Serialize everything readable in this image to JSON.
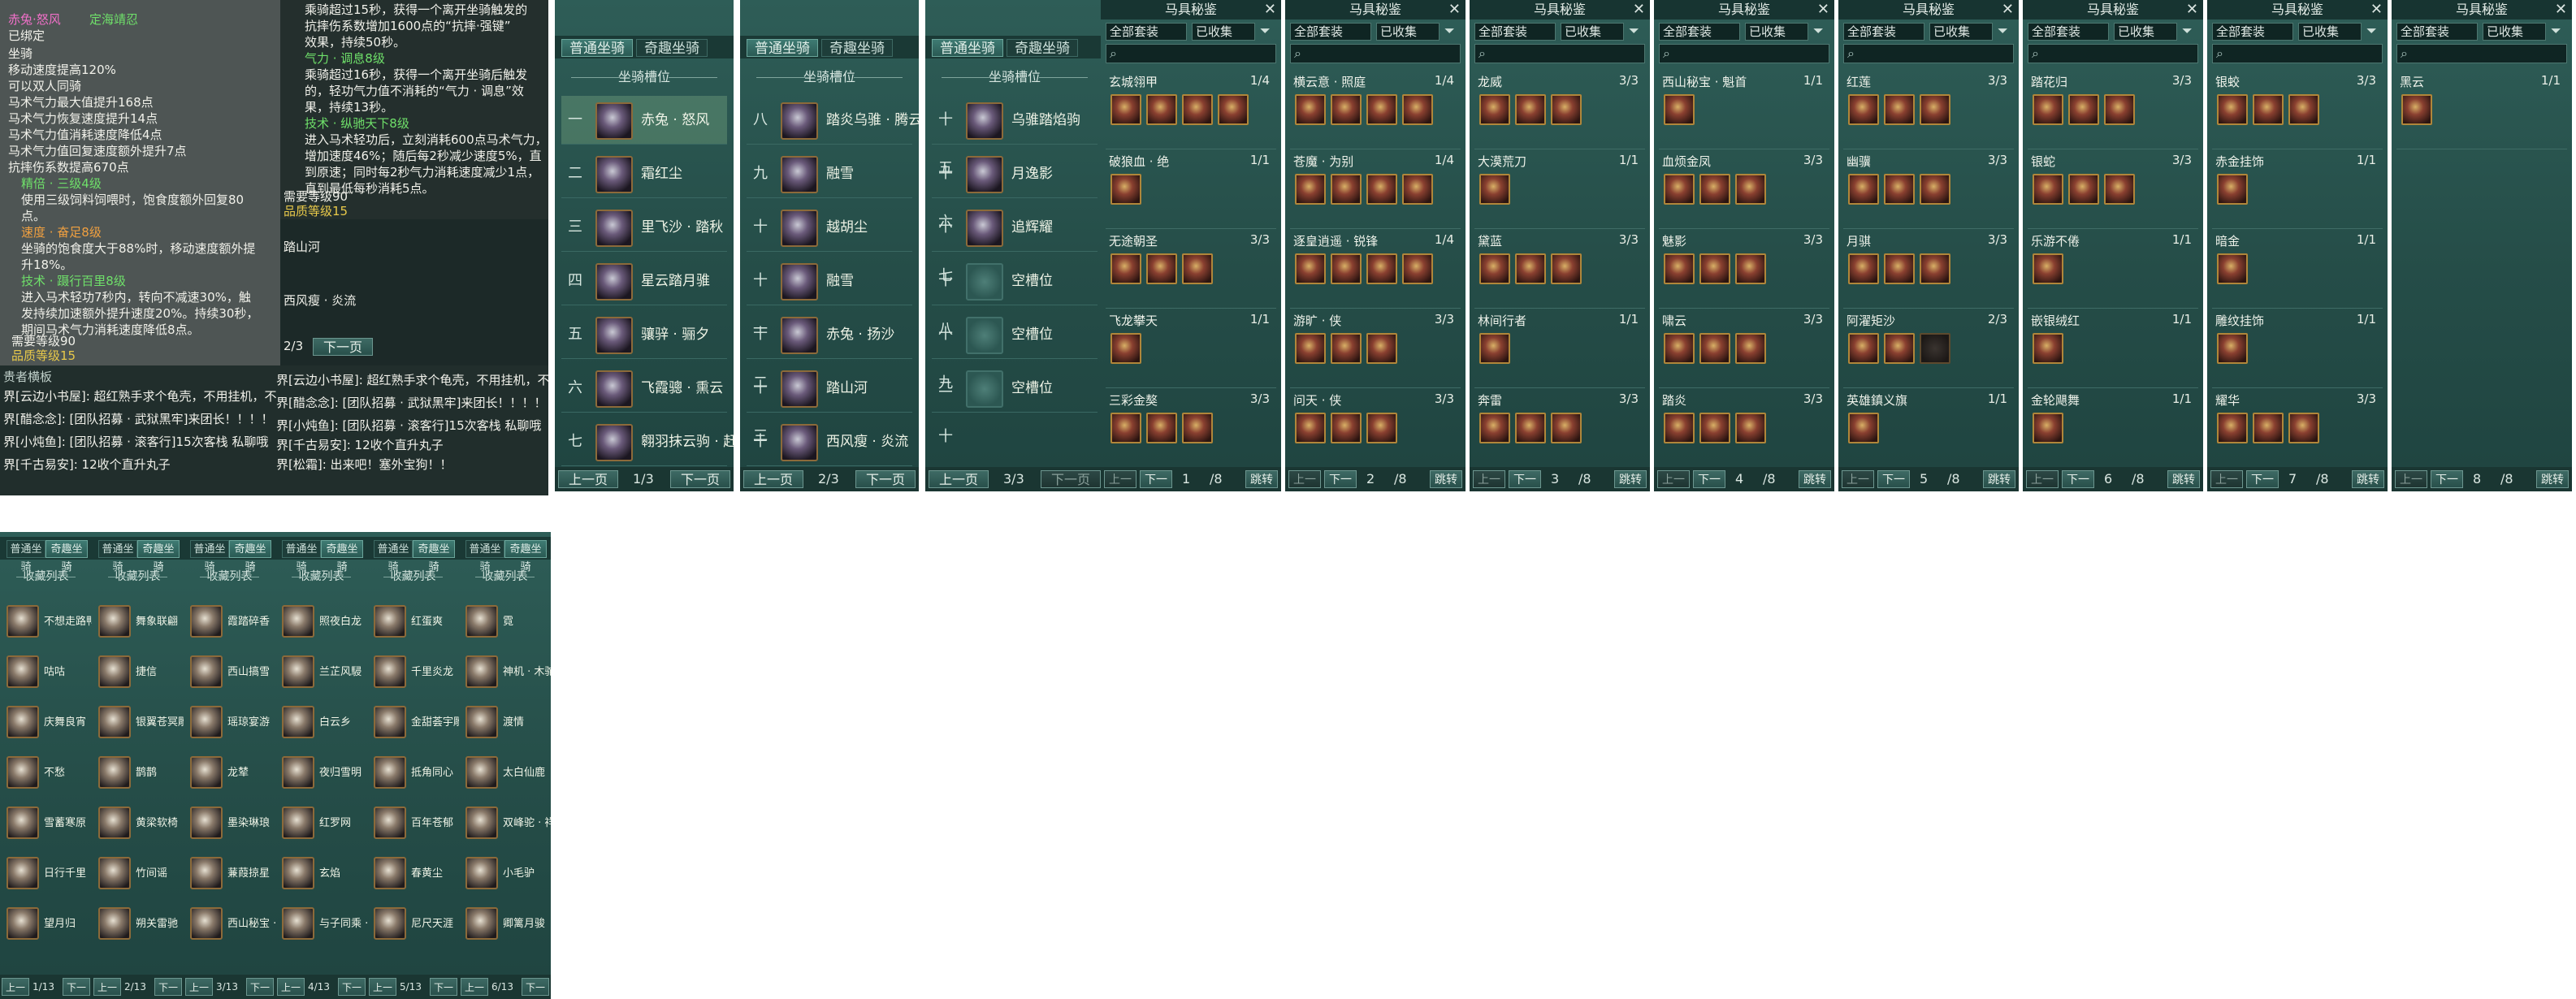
{
  "colors": {
    "teal_bg": "#2e5d57",
    "quality_gold": "#e8c94a",
    "skill_green": "#6fe06a",
    "title_pink": "#f070c8"
  },
  "tooltip": {
    "title": "赤兔·怒风",
    "tag": "定海靖忍",
    "status": "已绑定",
    "lines": [
      "坐骑",
      "移动速度提高120%",
      "可以双人同骑",
      "马术气力最大值提升168点",
      "马术气力恢复速度提升14点",
      "马术气力值消耗速度降低4点",
      "马术气力值回复速度额外提升7点",
      "抗摔伤系数提高670点"
    ],
    "skills": [
      {
        "name": "精倍 · 三级4级",
        "lines": [
          "使用三级饲料饲喂时，饱食度额外回复80",
          "点。"
        ]
      },
      {
        "name": "速度 · 奋足8级",
        "lines": [
          "坐骑的饱食度大于88%时，移动速度额外提",
          "升18%。"
        ]
      },
      {
        "name": "技术 · 蹑行百里8级",
        "lines": [
          "进入马术轻功7秒内，转向不减速30%，触",
          "发持续加速额外提升速度20%。持续30秒，",
          "期间马术气力消耗速度降低8点。"
        ]
      }
    ],
    "req_level": "需要等级90",
    "quality": "品质等级15",
    "right_lines": [
      "乘骑超过15秒，获得一个离开坐骑触发的",
      "抗摔伤系数增加1600点的“抗摔·强键”",
      "效果，持续50秒。"
    ],
    "right_skills": [
      {
        "name": "气力 · 调息8级",
        "lines": [
          "乘骑超过16秒，获得一个离开坐骑后触发",
          "的，轻功气力值不消耗的“气力 · 调息”效",
          "果，持续13秒。"
        ]
      },
      {
        "name": "技术 · 纵驰天下8级",
        "lines": [
          "进入马术轻功后，立刻消耗600点马术气力，",
          "增加速度46%；随后每2秒减少速度5%，直",
          "到原速；同时每2秒气力消耗速度减少1点，",
          "直到最低每秒消耗5点。"
        ]
      }
    ],
    "right_req": "需要等级90",
    "right_quality": "品质等级15"
  },
  "chat": {
    "lines": [
      "界[云边小书屋]: 超红熟手求个龟壳，不用挂机，不",
      "界[醋念念]: [团队招募 · 武狱黑牢]来团长！！！！",
      "界[小炖鱼]: [团队招募 · 滚客行]15次客栈 私聊哦",
      "界[千古易安]: 12收个直升丸子"
    ],
    "lines_b": [
      "界[云边小书屋]: 超红熟手求个龟壳，不用挂机，不",
      "界[醋念念]: [团队招募 · 武狱黑牢]来团长！！！！",
      "界[小炖鱼]: [团队招募 · 滚客行]15次客栈 私聊哦",
      "界[千古易安]: 12收个直升丸子",
      "界[松霜]: 出来吧！塞外宝狗！！"
    ],
    "top_line": "界[云边小书屋]: [团队招募·滚客行]15次宝阁 私聊哦",
    "top_line2": "贵者横板",
    "map_names": [
      "踏山河",
      "西风瘦 · 炎流"
    ],
    "page": "2/3",
    "next": "下一页"
  },
  "riding": {
    "tab_normal": "普通坐骑",
    "tab_wonder": "奇趣坐骑",
    "header": "坐骑槽位",
    "panels": [
      {
        "page": "1/3",
        "prev": "上一页",
        "next": "下一页",
        "items": [
          {
            "num": "一",
            "name": "赤兔 · 怒风",
            "sel": true
          },
          {
            "num": "二",
            "name": "霜红尘"
          },
          {
            "num": "三",
            "name": "里飞沙 · 踏秋"
          },
          {
            "num": "四",
            "name": "星云踏月骓"
          },
          {
            "num": "五",
            "name": "骧骍 · 骊夕"
          },
          {
            "num": "六",
            "name": "飞霞骢 · 熏云"
          },
          {
            "num": "七",
            "name": "翱羽抹云驹 · 赶月"
          }
        ]
      },
      {
        "page": "2/3",
        "prev": "上一页",
        "next": "下一页",
        "items": [
          {
            "num": "八",
            "name": "踏炎乌骓 · 腾云"
          },
          {
            "num": "九",
            "name": "融雪"
          },
          {
            "num": "十",
            "name": "越胡尘"
          },
          {
            "num": "十一",
            "name": "融雪"
          },
          {
            "num": "十二",
            "name": "赤兔 · 扬沙"
          },
          {
            "num": "十三",
            "name": "踏山河"
          },
          {
            "num": "十四",
            "name": "西风瘦 · 炎流"
          }
        ]
      },
      {
        "page": "3/3",
        "prev": "上一页",
        "next": "下一页",
        "items": [
          {
            "num": "十五",
            "name": "乌骓踏焰驹"
          },
          {
            "num": "十六",
            "name": "月逸影"
          },
          {
            "num": "十七",
            "name": "追辉耀"
          },
          {
            "num": "十八",
            "name": "空槽位",
            "empty": true
          },
          {
            "num": "十九",
            "name": "空槽位",
            "empty": true
          },
          {
            "num": "二十",
            "name": "空槽位",
            "empty": true
          }
        ]
      }
    ]
  },
  "equip": {
    "title": "马具秘鉴",
    "filter1": "全部套装",
    "filter2": "已收集",
    "prev": "上一页",
    "next": "下一页",
    "jump": "跳转",
    "total": "/8",
    "panels": [
      {
        "page": "1",
        "sets": [
          {
            "name": "玄城翎甲",
            "count": "1/4",
            "icons": 4
          },
          {
            "name": "破狼血 · 绝",
            "count": "1/1",
            "icons": 1
          },
          {
            "name": "无途朝圣",
            "count": "3/3",
            "icons": 3
          },
          {
            "name": "飞龙攀天",
            "count": "1/1",
            "icons": 1
          },
          {
            "name": "三彩金獒",
            "count": "3/3",
            "icons": 3
          }
        ]
      },
      {
        "page": "2",
        "sets": [
          {
            "name": "横云意 · 照庭",
            "count": "1/4",
            "icons": 4
          },
          {
            "name": "苍魔 · 为别",
            "count": "1/4",
            "icons": 4
          },
          {
            "name": "逐皇逍遥 · 锐锋",
            "count": "1/4",
            "icons": 4
          },
          {
            "name": "游旷 · 侠",
            "count": "3/3",
            "icons": 3
          },
          {
            "name": "问天 · 侠",
            "count": "3/3",
            "icons": 3
          }
        ]
      },
      {
        "page": "3",
        "sets": [
          {
            "name": "龙威",
            "count": "3/3",
            "icons": 3
          },
          {
            "name": "大漠荒刀",
            "count": "1/1",
            "icons": 1
          },
          {
            "name": "黛蓝",
            "count": "3/3",
            "icons": 3
          },
          {
            "name": "林间行者",
            "count": "1/1",
            "icons": 1
          },
          {
            "name": "奔雷",
            "count": "3/3",
            "icons": 3
          }
        ]
      },
      {
        "page": "4",
        "sets": [
          {
            "name": "西山秘宝 · 魁首",
            "count": "1/1",
            "icons": 1
          },
          {
            "name": "血烦金凤",
            "count": "3/3",
            "icons": 3
          },
          {
            "name": "魅影",
            "count": "3/3",
            "icons": 3
          },
          {
            "name": "啸云",
            "count": "3/3",
            "icons": 3
          },
          {
            "name": "踏炎",
            "count": "3/3",
            "icons": 3
          }
        ]
      },
      {
        "page": "5",
        "sets": [
          {
            "name": "红莲",
            "count": "3/3",
            "icons": 3
          },
          {
            "name": "幽骥",
            "count": "3/3",
            "icons": 3
          },
          {
            "name": "月骐",
            "count": "3/3",
            "icons": 3
          },
          {
            "name": "阿濯矩沙",
            "count": "2/3",
            "icons": 2
          },
          {
            "name": "英雄鎮义旗",
            "count": "1/1",
            "icons": 1
          }
        ]
      },
      {
        "page": "6",
        "sets": [
          {
            "name": "踏花归",
            "count": "3/3",
            "icons": 3
          },
          {
            "name": "银蛇",
            "count": "3/3",
            "icons": 3
          },
          {
            "name": "乐游不倦",
            "count": "1/1",
            "icons": 1
          },
          {
            "name": "嵌银绒红",
            "count": "1/1",
            "icons": 1
          },
          {
            "name": "金轮飓舞",
            "count": "1/1",
            "icons": 1
          }
        ]
      },
      {
        "page": "7",
        "sets": [
          {
            "name": "银蛟",
            "count": "3/3",
            "icons": 3
          },
          {
            "name": "赤金挂饰",
            "count": "1/1",
            "icons": 1
          },
          {
            "name": "暗金",
            "count": "1/1",
            "icons": 1
          },
          {
            "name": "雕纹挂饰",
            "count": "1/1",
            "icons": 1
          },
          {
            "name": "耀华",
            "count": "3/3",
            "icons": 3
          }
        ]
      },
      {
        "page": "8",
        "sets": [
          {
            "name": "黑云",
            "count": "1/1",
            "icons": 1
          }
        ]
      }
    ]
  },
  "collection": {
    "tab_normal": "普通坐骑",
    "tab_wonder": "奇趣坐骑",
    "header": "收藏列表",
    "prev": "上一页",
    "next": "下一页",
    "panels": [
      {
        "page": "1/13",
        "items": [
          "不想走路鸭",
          "咕咕",
          "庆舞良宵",
          "不愁",
          "雪蓄寒原",
          "日行千里",
          "望月归"
        ]
      },
      {
        "page": "2/13",
        "items": [
          "舞象联翩",
          "捷信",
          "银翼苍冥雕",
          "鹊鹊",
          "黄梁软椅",
          "竹间谣",
          "朔关雷驰"
        ]
      },
      {
        "page": "3/13",
        "items": [
          "霞踏碎香",
          "西山搞雪",
          "瑶琼宴游",
          "龙辇",
          "墨染琳琅",
          "蒹葭掠星",
          "西山秘宝 · 黛篁霓舆"
        ]
      },
      {
        "page": "4/13",
        "items": [
          "照夜白龙",
          "兰芷风駸",
          "白云乡",
          "夜归雪明",
          "红罗网",
          "玄焰",
          "与子同乘 · 看花归"
        ]
      },
      {
        "page": "5/13",
        "items": [
          "红蛋爽",
          "千里炎龙",
          "金甜荟宇雕",
          "抵角同心",
          "百年苍郁",
          "春黄尘",
          "尼尺天涯"
        ]
      },
      {
        "page": "6/13",
        "items": [
          "霓",
          "神机 · 木驼",
          "渡情",
          "太白仙鹿",
          "双峰驼 · 祥祥",
          "小毛驴",
          "卿篱月骏"
        ]
      }
    ]
  }
}
